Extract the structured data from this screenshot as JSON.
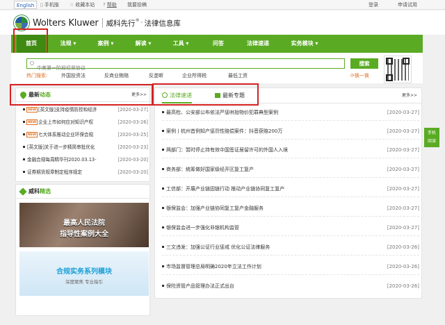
{
  "topbar": {
    "lang": "English",
    "links": [
      "手机版",
      "收藏本站",
      "帮助",
      "我要投稿"
    ],
    "right": [
      "登录",
      "申请试用"
    ]
  },
  "header": {
    "brand": "Wolters Kluwer",
    "cn_brand": "威科先行",
    "cn_reg": "®",
    "cn_sub": "法律信息库"
  },
  "nav": {
    "items": [
      "首页",
      "法规",
      "案例",
      "解读",
      "工具",
      "问答",
      "法律速递",
      "实务模块"
    ]
  },
  "search": {
    "placeholder": "中美第一阶段经贸协议",
    "button": "搜索",
    "hot_label": "热门搜索:",
    "hot_items": [
      "外国投资法",
      "反商业贿赂",
      "反垄断",
      "企业所得税",
      "最低工资"
    ],
    "swap": "换一换"
  },
  "news": {
    "title_a": "最新",
    "title_b": "动态",
    "more": "更多>>",
    "items": [
      {
        "text": "[英文版]支持疫情防控和经济",
        "date": "[2020-03-27]",
        "isnew": true
      },
      {
        "text": "企业上市如何应对知识产权",
        "date": "[2020-03-26]",
        "isnew": true
      },
      {
        "text": "七大体系推动企业环保合规",
        "date": "[2020-03-25]",
        "isnew": true
      },
      {
        "text": "[英文版]关于进一步精简审批优化",
        "date": "[2020-03-23]",
        "isnew": false
      },
      {
        "text": "金融合规每周精华刊2020.03.13-",
        "date": "[2020-03-20]",
        "isnew": false
      },
      {
        "text": "证券期货规章制定程序规定",
        "date": "[2020-03-20]",
        "isnew": false
      }
    ]
  },
  "jingxuan": {
    "title_a": "威科",
    "title_b": "精选",
    "banner1_line1": "最高人民法院",
    "banner1_line2": "指导性案例大全",
    "banner2_title": "合规实务系列模块",
    "banner2_sub": "深度聚焦  专业指引"
  },
  "express": {
    "tab1": "法律速递",
    "tab2": "最新专题",
    "more": "更多>>",
    "items": [
      {
        "text": "最高检、公安部公布依法严惩哄抬物价犯罪典型案例",
        "date": "[2020-03-27]"
      },
      {
        "text": "案例丨杭州首例知产惩罚性赔偿案件：抖音获赔200万",
        "date": "[2020-03-27]"
      },
      {
        "text": "两部门：暂时停止持有效中国签证居留许可的外国人入境",
        "date": "[2020-03-27]"
      },
      {
        "text": "商务部：统筹做好国家级经开区复工复产",
        "date": "[2020-03-27]"
      },
      {
        "text": "工信部：开展产业链固链行动 推动产业链协同复工复产",
        "date": "[2020-03-27]"
      },
      {
        "text": "银保监会：加强产业链协同复工复产金融服务",
        "date": "[2020-03-27]"
      },
      {
        "text": "银保监会进一步强化非银机构监管",
        "date": "[2020-03-27]"
      },
      {
        "text": "三文违发：加强公证行业惩戒 优化公证法律服务",
        "date": "[2020-03-26]"
      },
      {
        "text": "市场监督管理总局明确2020年立法工作计划",
        "date": "[2020-03-26]"
      },
      {
        "text": "保险资管产品管理办法正式出台",
        "date": "[2020-03-26]"
      }
    ]
  },
  "mobile_float": {
    "line1": "手机",
    "line2": "阅读"
  },
  "colors": {
    "brand_green": "#5aab23",
    "highlight_red": "#d42121",
    "hot_orange": "#e07020"
  }
}
